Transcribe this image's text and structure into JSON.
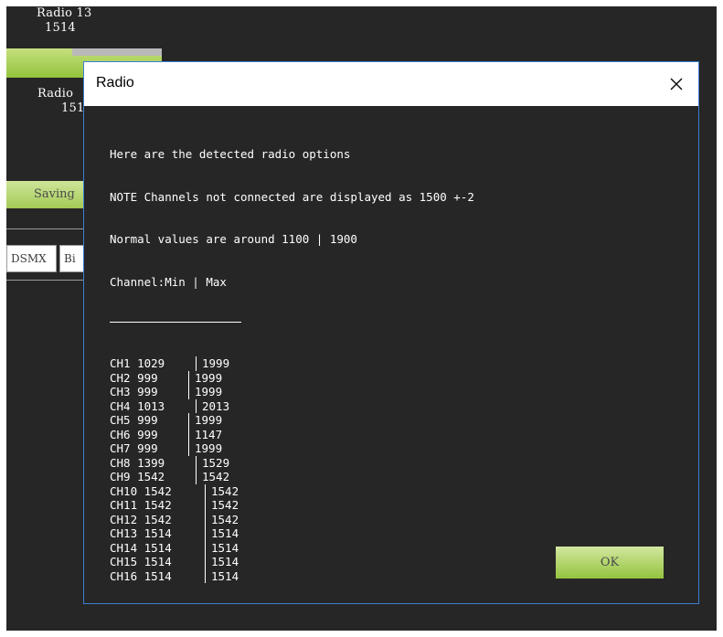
{
  "background": {
    "radio13_label": "Radio 13",
    "radio13_value": "1514",
    "radio14_label": "Radio",
    "radio14_value": "151",
    "saving_label": "Saving",
    "tab_dsmx": "DSMX",
    "tab_bi": "Bi"
  },
  "dialog": {
    "title": "Radio",
    "close_glyph": "✕",
    "intro": [
      "Here are the detected radio options",
      "NOTE Channels not connected are displayed as 1500 +-2",
      "Normal values are around 1100 | 1900",
      "Channel:Min | Max"
    ],
    "channels": [
      {
        "name": "CH1",
        "min": "1029",
        "max": "1999"
      },
      {
        "name": "CH2",
        "min": "999",
        "max": "1999"
      },
      {
        "name": "CH3",
        "min": "999",
        "max": "1999"
      },
      {
        "name": "CH4",
        "min": "1013",
        "max": "2013"
      },
      {
        "name": "CH5",
        "min": "999",
        "max": "1999"
      },
      {
        "name": "CH6",
        "min": "999",
        "max": "1147"
      },
      {
        "name": "CH7",
        "min": "999",
        "max": "1999"
      },
      {
        "name": "CH8",
        "min": "1399",
        "max": "1529"
      },
      {
        "name": "CH9",
        "min": "1542",
        "max": "1542"
      },
      {
        "name": "CH10",
        "min": "1542",
        "max": "1542"
      },
      {
        "name": "CH11",
        "min": "1542",
        "max": "1542"
      },
      {
        "name": "CH12",
        "min": "1542",
        "max": "1542"
      },
      {
        "name": "CH13",
        "min": "1514",
        "max": "1514"
      },
      {
        "name": "CH14",
        "min": "1514",
        "max": "1514"
      },
      {
        "name": "CH15",
        "min": "1514",
        "max": "1514"
      },
      {
        "name": "CH16",
        "min": "1514",
        "max": "1514"
      }
    ],
    "ok_label": "OK"
  },
  "colors": {
    "dialog_bg": "#262626",
    "accent_green": "#94c43e",
    "dialog_border": "#3a7fd0"
  }
}
